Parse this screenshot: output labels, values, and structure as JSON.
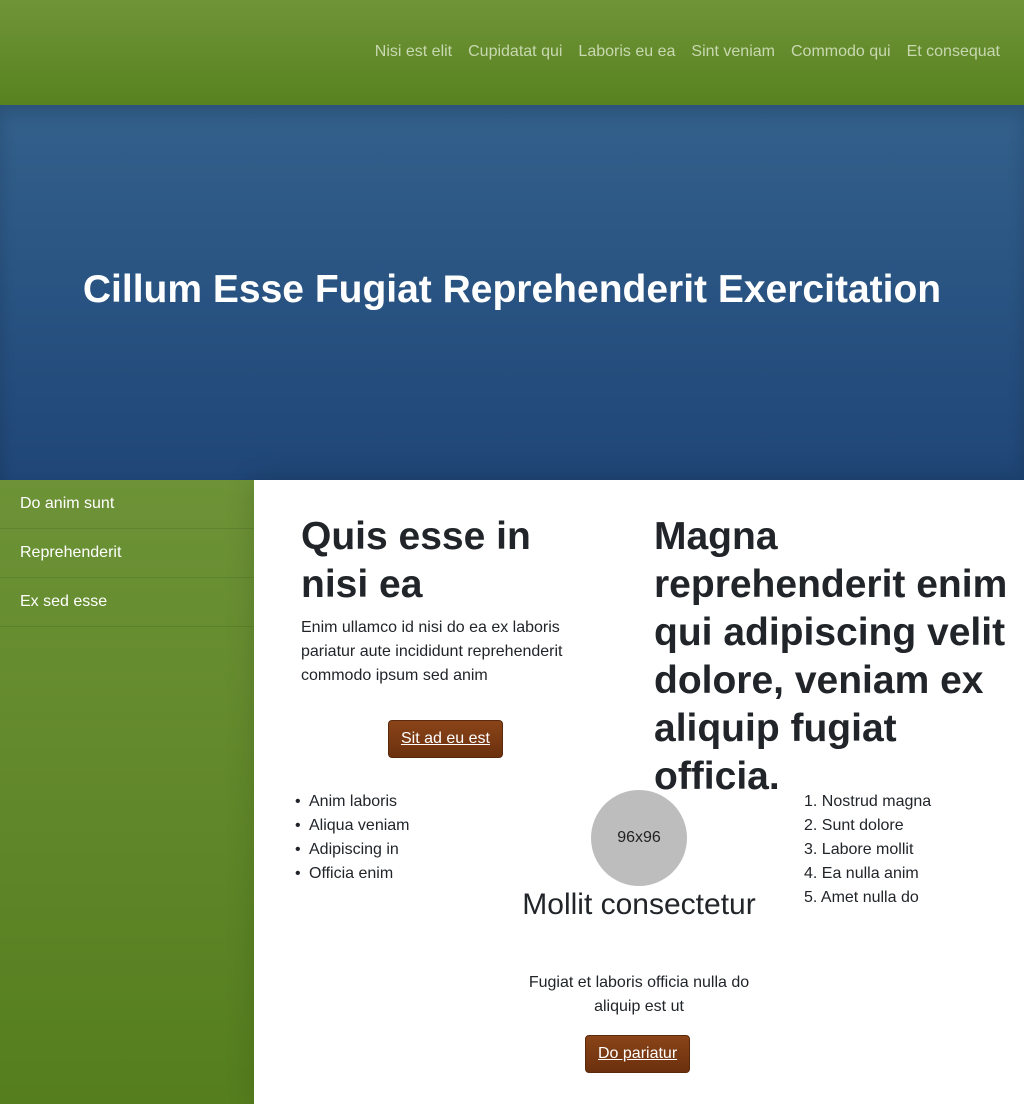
{
  "nav": {
    "items": [
      "Nisi est elit",
      "Cupidatat qui",
      "Laboris eu ea",
      "Sint veniam",
      "Commodo qui",
      "Et consequat"
    ]
  },
  "hero": {
    "title": "Cillum Esse Fugiat Reprehenderit Exercitation"
  },
  "sidebar": {
    "items": [
      "Do anim sunt",
      "Reprehenderit",
      "Ex sed esse"
    ]
  },
  "card1": {
    "title": "Quis esse in nisi ea",
    "text": "Enim ullamco id nisi do ea ex laboris pariatur aute incididunt reprehenderit commodo ipsum sed anim",
    "button": "Sit ad eu est"
  },
  "quote": "Magna reprehenderit enim qui adipiscing velit dolore, veniam ex aliquip fugiat officia.",
  "bullets": [
    "Anim laboris",
    "Aliqua veniam",
    "Adipiscing in",
    "Officia enim"
  ],
  "card2": {
    "avatar": "96x96",
    "title": "Mollit consectetur",
    "text": "Fugiat et laboris officia nulla do aliquip est ut",
    "button": "Do pariatur"
  },
  "numbered": [
    "1. Nostrud magna",
    "2. Sunt dolore",
    "3. Labore mollit",
    "4. Ea nulla anim",
    "5. Amet nulla do"
  ],
  "colors": {
    "nav_green": "#6f9438",
    "hero_blue": "#2d5a88",
    "button_brown": "#7b3a13"
  }
}
